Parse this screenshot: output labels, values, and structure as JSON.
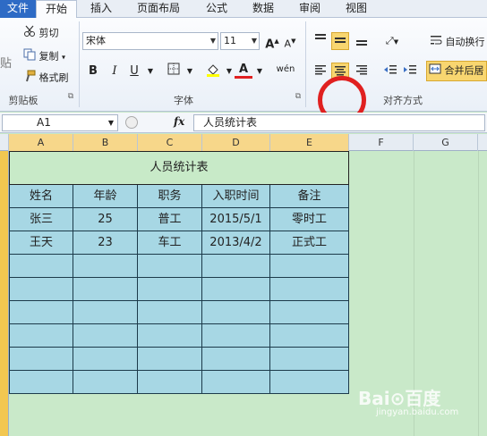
{
  "tabs": {
    "file": "文件",
    "home": "开始",
    "insert": "插入",
    "layout": "页面布局",
    "formula": "公式",
    "data": "数据",
    "review": "审阅",
    "view": "视图"
  },
  "clipboard": {
    "paste": "贴",
    "cut": "剪切",
    "copy": "复制",
    "format_painter": "格式刷",
    "group": "剪贴板"
  },
  "font": {
    "name": "宋体",
    "size": "11",
    "group": "字体",
    "bold": "B",
    "italic": "I",
    "underline": "U",
    "font_color_letter": "A",
    "grow": "A",
    "shrink": "A",
    "phonetic": "wén"
  },
  "alignment": {
    "wrap_text": "自动换行",
    "merge_center": "合并后居",
    "group": "对齐方式"
  },
  "formula_bar": {
    "name_box": "A1",
    "fx": "fx",
    "content": "人员统计表"
  },
  "columns": [
    "A",
    "B",
    "C",
    "D",
    "E",
    "F",
    "G"
  ],
  "table": {
    "title": "人员统计表",
    "headers": [
      "姓名",
      "年龄",
      "职务",
      "入职时间",
      "备注"
    ],
    "rows": [
      [
        "张三",
        "25",
        "普工",
        "2015/5/1",
        "零时工"
      ],
      [
        "王天",
        "23",
        "车工",
        "2013/4/2",
        "正式工"
      ],
      [
        "",
        "",
        "",
        "",
        ""
      ],
      [
        "",
        "",
        "",
        "",
        ""
      ],
      [
        "",
        "",
        "",
        "",
        ""
      ],
      [
        "",
        "",
        "",
        "",
        ""
      ],
      [
        "",
        "",
        "",
        "",
        ""
      ],
      [
        "",
        "",
        "",
        "",
        ""
      ]
    ]
  },
  "watermark": {
    "brand": "Bai⊙百度",
    "sub": "jingyan.baidu.com"
  },
  "colors": {
    "sheet_bg": "#c9e9c9",
    "table_fill": "#a7d7e4",
    "highlight_circle": "#e02020"
  }
}
